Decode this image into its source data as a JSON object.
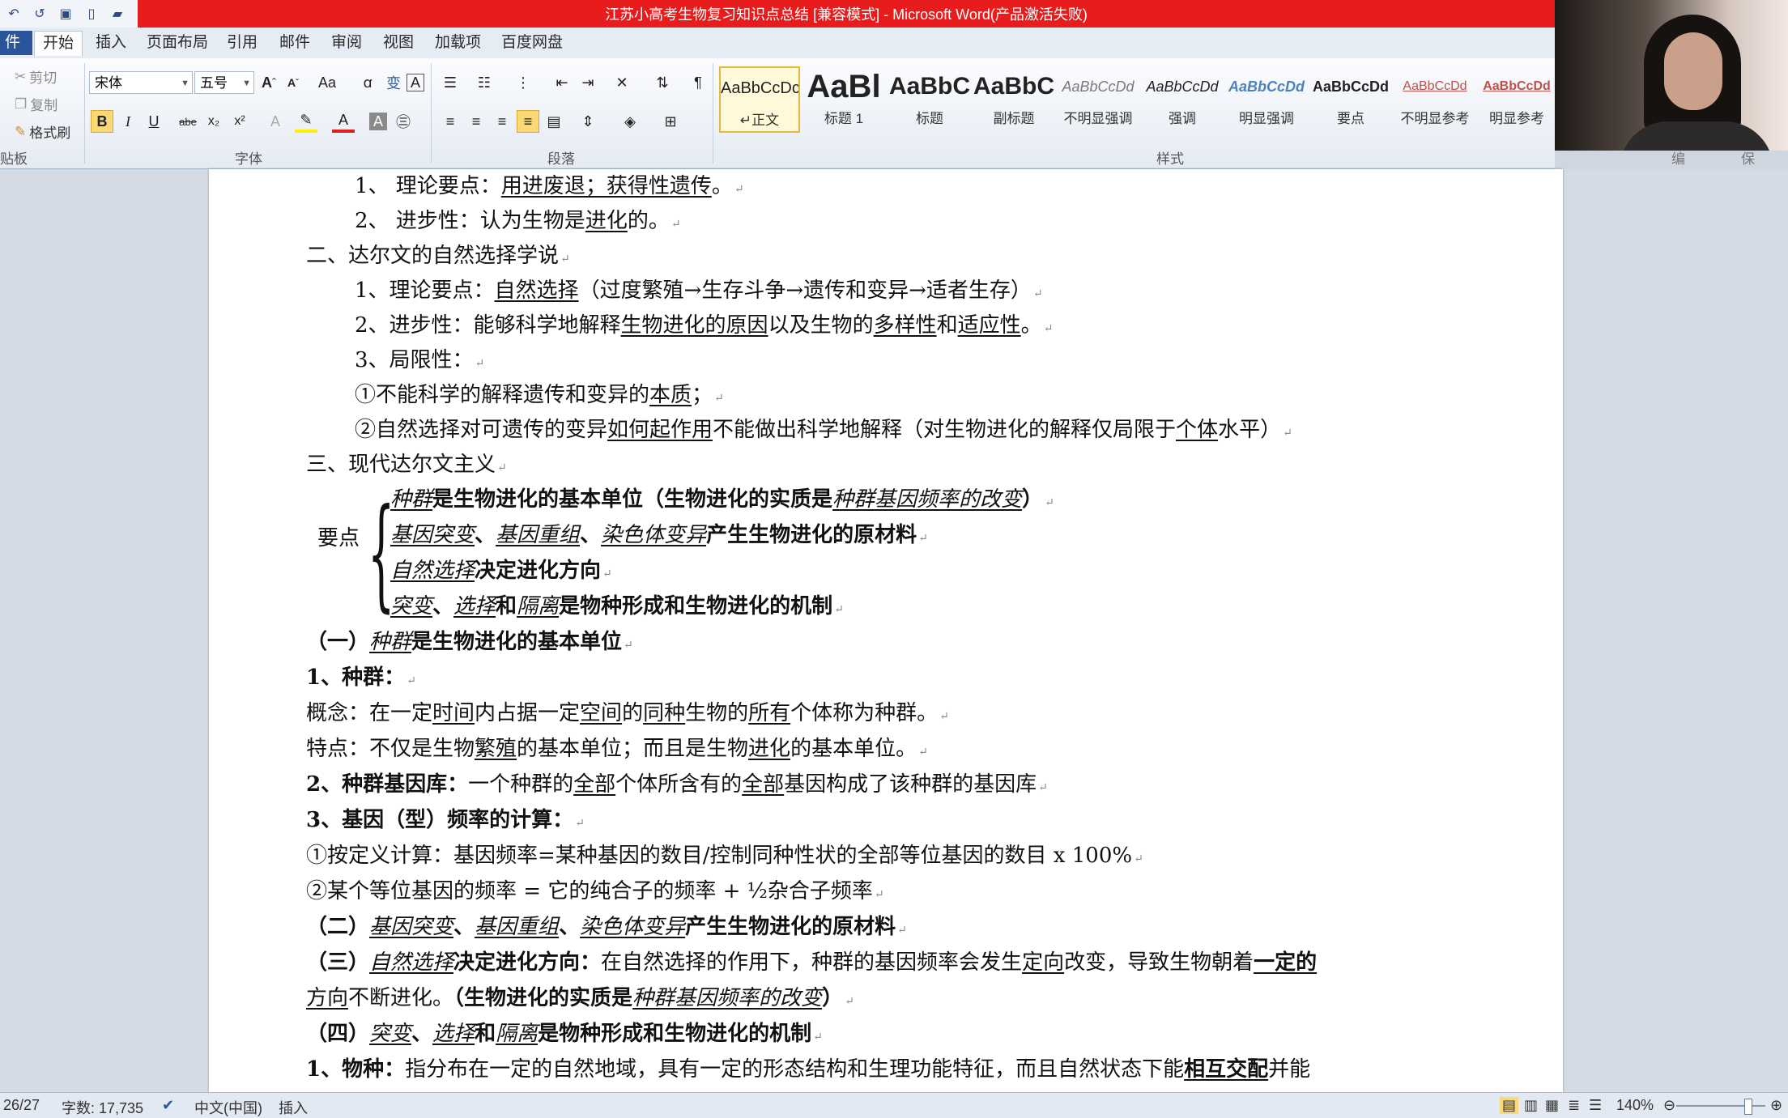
{
  "window": {
    "title": "江苏小高考生物复习知识点总结 [兼容模式] - Microsoft Word(产品激活失败)"
  },
  "ribbon_tabs": [
    "件",
    "开始",
    "插入",
    "页面布局",
    "引用",
    "邮件",
    "审阅",
    "视图",
    "加载项",
    "百度网盘"
  ],
  "clipboard": {
    "cut": "剪切",
    "copy": "复制",
    "format_painter": "格式刷",
    "group": "贴板"
  },
  "font": {
    "name": "宋体",
    "size": "五号",
    "group": "字体"
  },
  "paragraph": {
    "group": "段落"
  },
  "styles": {
    "group": "样式",
    "items": [
      {
        "sample": "AaBbCcDc",
        "name": "↵正文"
      },
      {
        "sample": "AaBl",
        "name": "标题 1"
      },
      {
        "sample": "AaBbC",
        "name": "标题"
      },
      {
        "sample": "AaBbC",
        "name": "副标题"
      },
      {
        "sample": "AaBbCcDd",
        "name": "不明显强调"
      },
      {
        "sample": "AaBbCcDd",
        "name": "强调"
      },
      {
        "sample": "AaBbCcDd",
        "name": "明显强调"
      },
      {
        "sample": "AaBbCcDd",
        "name": "要点"
      },
      {
        "sample": "AaBbCcDd",
        "name": "不明显参考"
      },
      {
        "sample": "AaBbCcDd",
        "name": "明显参考"
      }
    ]
  },
  "right_groups": {
    "edit": "编辑",
    "save": "保存"
  },
  "doc": {
    "l1a": "1、 理论要点：",
    "l1b": "用进废退；获得性遗传",
    "l1c": "。",
    "l2a": "2、 进步性：认为生物是",
    "l2b": "进化",
    "l2c": "的。",
    "h2": "二、达尔文的自然选择学说",
    "l3a": "1、理论要点：",
    "l3b": "自然选择",
    "l3c": "（过度繁殖→生存斗争→遗传和变异→适者生存）",
    "l4a": "2、进步性：能够科学地解释",
    "l4b": "生物进化的原因",
    "l4c": "以及生物的",
    "l4d": "多样性",
    "l4e": "和",
    "l4f": "适应性",
    "l4g": "。",
    "l5": "3、局限性：",
    "l6a": "①不能科学的解释遗传和变异的",
    "l6b": "本质",
    "l6c": "；",
    "l7a": "②自然选择对可遗传的变异",
    "l7b": "如何起作用",
    "l7c": "不能做出科学地解释（对生物进化的解释仅局限于",
    "l7d": "个体",
    "l7e": "水平）",
    "h3": "三、现代达尔文主义",
    "yd": "要点",
    "p1a": "种群",
    "p1b": "是生物进化的基本单位（生物进化的实质是",
    "p1c": "种群基因频率的改变",
    "p1d": "）",
    "p2a": "基因突变",
    "p2b": "、",
    "p2c": "基因重组",
    "p2d": "、",
    "p2e": "染色体变异",
    "p2f": "产生生物进化的原材料",
    "p3a": "自然选择",
    "p3b": "决定进化方向",
    "p4a": "突变",
    "p4b": "、",
    "p4c": "选择",
    "p4d": "和",
    "p4e": "隔离",
    "p4f": "是物种形成和生物进化的机制",
    "s1a": "（一）",
    "s1b": "种群",
    "s1c": "是生物进化的基本单位",
    "z1": "1、种群：",
    "gn_a": "概念：在一定",
    "gn_b": "时间",
    "gn_c": "内占据一定",
    "gn_d": "空间",
    "gn_e": "的",
    "gn_f": "同种",
    "gn_g": "生物的",
    "gn_h": "所有",
    "gn_i": "个体称为种群。",
    "td_a": "特点：不仅是生物",
    "td_b": "繁殖",
    "td_c": "的基本单位；而且是生物",
    "td_d": "进化",
    "td_e": "的基本单位。",
    "jk_a": "2、种群基因库：",
    "jk_b": "一个种群的",
    "jk_c": "全部",
    "jk_d": "个体所含有的",
    "jk_e": "全部",
    "jk_f": "基因构成了该种群的基因库",
    "pl_a": "3、基因（型）频率的计算：",
    "pl1": "①按定义计算：基因频率=某种基因的数目/控制同种性状的全部等位基因的数目 x 100%",
    "pl2": "②某个等位基因的频率  =  它的纯合子的频率  +   ½杂合子频率",
    "s2a": "（二）",
    "s2b": "基因突变",
    "s2c": "、",
    "s2d": "基因重组",
    "s2e": "、",
    "s2f": "染色体变异",
    "s2g": "产生生物进化的原材料",
    "s3a": "（三）",
    "s3b": "自然选择",
    "s3c": "决定进化方向：",
    "s3d": "在自然选择的作用下，种群的基因频率会发生",
    "s3e": "定向",
    "s3f": "改变，导致生物朝着",
    "s3g": "一定的",
    "s3h": "方向",
    "s3i": "不断进化。",
    "s3j": "（生物进化的实质是",
    "s3k": "种群基因频率的改变",
    "s3l": "）",
    "s4a": "（四）",
    "s4b": "突变",
    "s4c": "、",
    "s4d": "选择",
    "s4e": "和",
    "s4f": "隔离",
    "s4g": "是物种形成和生物进化的机制",
    "wz_a": "1、物种：",
    "wz_b": "指分布在一定的自然地域，具有一定的形态结构和生理功能特征，而且自然状态下能",
    "wz_c": "相互交配",
    "wz_d": "并能"
  },
  "status": {
    "page": "26/27",
    "words": "字数: 17,735",
    "lang": "中文(中国)",
    "mode": "插入",
    "zoom": "140%"
  }
}
